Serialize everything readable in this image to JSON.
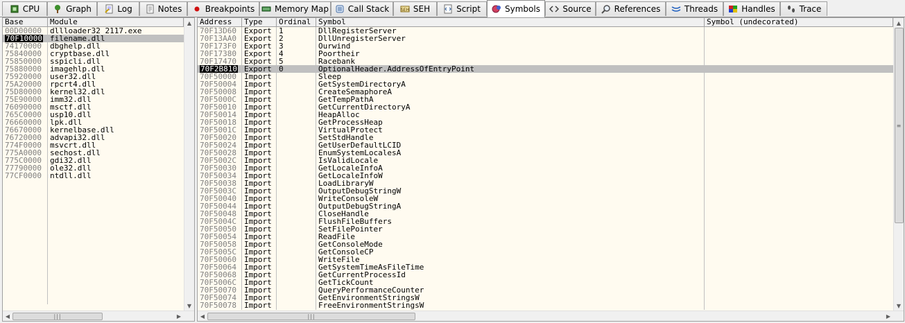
{
  "tabs": [
    {
      "label": "CPU",
      "icon": "cpu-icon",
      "active": false
    },
    {
      "label": "Graph",
      "icon": "graph-icon",
      "active": false
    },
    {
      "label": "Log",
      "icon": "log-icon",
      "active": false
    },
    {
      "label": "Notes",
      "icon": "notes-icon",
      "active": false
    },
    {
      "label": "Breakpoints",
      "icon": "breakpoint-icon",
      "active": false
    },
    {
      "label": "Memory Map",
      "icon": "memory-map-icon",
      "active": false
    },
    {
      "label": "Call Stack",
      "icon": "call-stack-icon",
      "active": false
    },
    {
      "label": "SEH",
      "icon": "seh-icon",
      "active": false
    },
    {
      "label": "Script",
      "icon": "script-icon",
      "active": false
    },
    {
      "label": "Symbols",
      "icon": "symbols-icon",
      "active": true
    },
    {
      "label": "Source",
      "icon": "source-icon",
      "active": false
    },
    {
      "label": "References",
      "icon": "references-icon",
      "active": false
    },
    {
      "label": "Threads",
      "icon": "threads-icon",
      "active": false
    },
    {
      "label": "Handles",
      "icon": "handles-icon",
      "active": false
    },
    {
      "label": "Trace",
      "icon": "trace-icon",
      "active": false
    }
  ],
  "modules": {
    "headers": {
      "base": "Base",
      "module": "Module"
    },
    "rows": [
      {
        "base": "00D00000",
        "name": "dllloader32_2117.exe"
      },
      {
        "base": "70F10000",
        "name": "filename.dll",
        "selected": true
      },
      {
        "base": "74170000",
        "name": "dbghelp.dll"
      },
      {
        "base": "75840000",
        "name": "cryptbase.dll"
      },
      {
        "base": "75850000",
        "name": "sspicli.dll"
      },
      {
        "base": "75880000",
        "name": "imagehlp.dll"
      },
      {
        "base": "75920000",
        "name": "user32.dll"
      },
      {
        "base": "75A20000",
        "name": "rpcrt4.dll"
      },
      {
        "base": "75D80000",
        "name": "kernel32.dll"
      },
      {
        "base": "75E90000",
        "name": "imm32.dll"
      },
      {
        "base": "76090000",
        "name": "msctf.dll"
      },
      {
        "base": "765C0000",
        "name": "usp10.dll"
      },
      {
        "base": "76660000",
        "name": "lpk.dll"
      },
      {
        "base": "76670000",
        "name": "kernelbase.dll"
      },
      {
        "base": "76720000",
        "name": "advapi32.dll"
      },
      {
        "base": "774F0000",
        "name": "msvcrt.dll"
      },
      {
        "base": "775A0000",
        "name": "sechost.dll"
      },
      {
        "base": "775C0000",
        "name": "gdi32.dll"
      },
      {
        "base": "77790000",
        "name": "ole32.dll"
      },
      {
        "base": "77CF0000",
        "name": "ntdll.dll"
      }
    ]
  },
  "symbols": {
    "headers": {
      "address": "Address",
      "type": "Type",
      "ordinal": "Ordinal",
      "symbol": "Symbol",
      "undecorated": "Symbol (undecorated)"
    },
    "rows": [
      {
        "address": "70F13D60",
        "type": "Export",
        "ordinal": "1",
        "symbol": "DllRegisterServer"
      },
      {
        "address": "70F13AA0",
        "type": "Export",
        "ordinal": "2",
        "symbol": "DllUnregisterServer"
      },
      {
        "address": "70F173F0",
        "type": "Export",
        "ordinal": "3",
        "symbol": "Ourwind"
      },
      {
        "address": "70F17380",
        "type": "Export",
        "ordinal": "4",
        "symbol": "Poortheir"
      },
      {
        "address": "70F17470",
        "type": "Export",
        "ordinal": "5",
        "symbol": "Racebank"
      },
      {
        "address": "70F2B810",
        "type": "Export",
        "ordinal": "0",
        "symbol": "OptionalHeader.AddressOfEntryPoint",
        "selected": true
      },
      {
        "address": "70F50000",
        "type": "Import",
        "ordinal": "",
        "symbol": "Sleep"
      },
      {
        "address": "70F50004",
        "type": "Import",
        "ordinal": "",
        "symbol": "GetSystemDirectoryA"
      },
      {
        "address": "70F50008",
        "type": "Import",
        "ordinal": "",
        "symbol": "CreateSemaphoreA"
      },
      {
        "address": "70F5000C",
        "type": "Import",
        "ordinal": "",
        "symbol": "GetTempPathA"
      },
      {
        "address": "70F50010",
        "type": "Import",
        "ordinal": "",
        "symbol": "GetCurrentDirectoryA"
      },
      {
        "address": "70F50014",
        "type": "Import",
        "ordinal": "",
        "symbol": "HeapAlloc"
      },
      {
        "address": "70F50018",
        "type": "Import",
        "ordinal": "",
        "symbol": "GetProcessHeap"
      },
      {
        "address": "70F5001C",
        "type": "Import",
        "ordinal": "",
        "symbol": "VirtualProtect"
      },
      {
        "address": "70F50020",
        "type": "Import",
        "ordinal": "",
        "symbol": "SetStdHandle"
      },
      {
        "address": "70F50024",
        "type": "Import",
        "ordinal": "",
        "symbol": "GetUserDefaultLCID"
      },
      {
        "address": "70F50028",
        "type": "Import",
        "ordinal": "",
        "symbol": "EnumSystemLocalesA"
      },
      {
        "address": "70F5002C",
        "type": "Import",
        "ordinal": "",
        "symbol": "IsValidLocale"
      },
      {
        "address": "70F50030",
        "type": "Import",
        "ordinal": "",
        "symbol": "GetLocaleInfoA"
      },
      {
        "address": "70F50034",
        "type": "Import",
        "ordinal": "",
        "symbol": "GetLocaleInfoW"
      },
      {
        "address": "70F50038",
        "type": "Import",
        "ordinal": "",
        "symbol": "LoadLibraryW"
      },
      {
        "address": "70F5003C",
        "type": "Import",
        "ordinal": "",
        "symbol": "OutputDebugStringW"
      },
      {
        "address": "70F50040",
        "type": "Import",
        "ordinal": "",
        "symbol": "WriteConsoleW"
      },
      {
        "address": "70F50044",
        "type": "Import",
        "ordinal": "",
        "symbol": "OutputDebugStringA"
      },
      {
        "address": "70F50048",
        "type": "Import",
        "ordinal": "",
        "symbol": "CloseHandle"
      },
      {
        "address": "70F5004C",
        "type": "Import",
        "ordinal": "",
        "symbol": "FlushFileBuffers"
      },
      {
        "address": "70F50050",
        "type": "Import",
        "ordinal": "",
        "symbol": "SetFilePointer"
      },
      {
        "address": "70F50054",
        "type": "Import",
        "ordinal": "",
        "symbol": "ReadFile"
      },
      {
        "address": "70F50058",
        "type": "Import",
        "ordinal": "",
        "symbol": "GetConsoleMode"
      },
      {
        "address": "70F5005C",
        "type": "Import",
        "ordinal": "",
        "symbol": "GetConsoleCP"
      },
      {
        "address": "70F50060",
        "type": "Import",
        "ordinal": "",
        "symbol": "WriteFile"
      },
      {
        "address": "70F50064",
        "type": "Import",
        "ordinal": "",
        "symbol": "GetSystemTimeAsFileTime"
      },
      {
        "address": "70F50068",
        "type": "Import",
        "ordinal": "",
        "symbol": "GetCurrentProcessId"
      },
      {
        "address": "70F5006C",
        "type": "Import",
        "ordinal": "",
        "symbol": "GetTickCount"
      },
      {
        "address": "70F50070",
        "type": "Import",
        "ordinal": "",
        "symbol": "QueryPerformanceCounter"
      },
      {
        "address": "70F50074",
        "type": "Import",
        "ordinal": "",
        "symbol": "GetEnvironmentStringsW"
      },
      {
        "address": "70F50078",
        "type": "Import",
        "ordinal": "",
        "symbol": "FreeEnvironmentStringsW"
      }
    ]
  },
  "colors": {
    "pane_background": "#fffbf0",
    "selected_row": "#c0c0c0",
    "address_gray": "#808080",
    "selected_address_bg": "#000000"
  }
}
